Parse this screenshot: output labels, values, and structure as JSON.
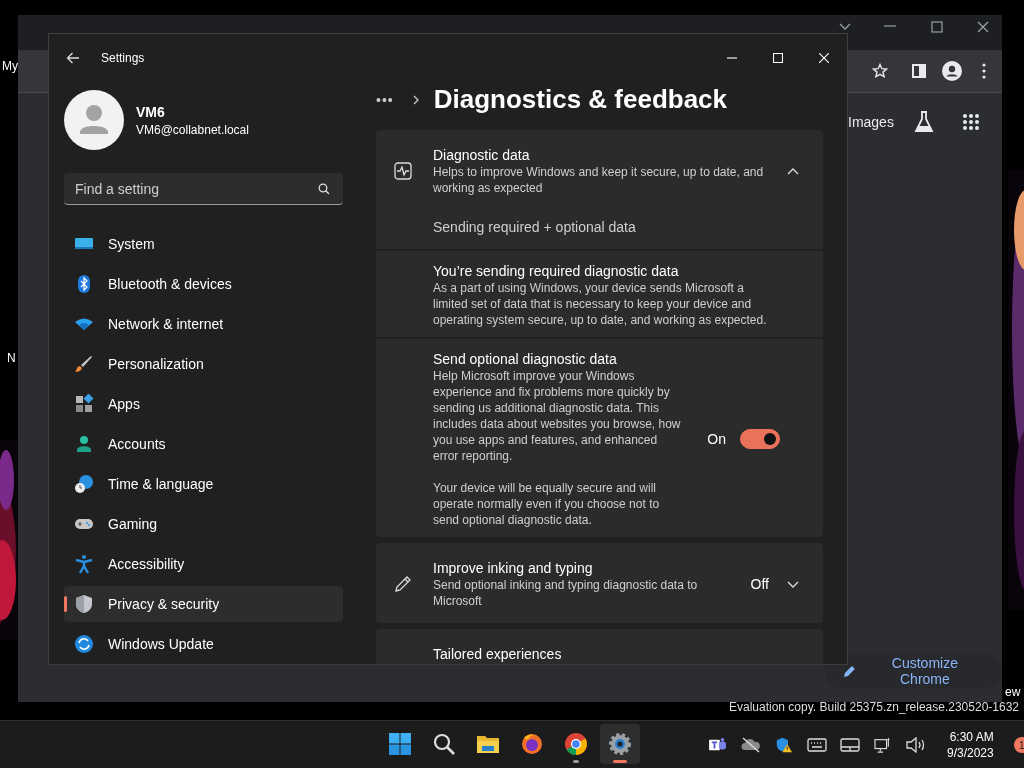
{
  "desktop": {
    "icon_labels": [
      {
        "text": "My",
        "kind": "top"
      },
      {
        "text": "N",
        "kind": "middle"
      },
      {
        "text": "ew",
        "kind": "right"
      }
    ],
    "build_info": "Evaluation copy. Build 25375.zn_release.230520-1632"
  },
  "browser": {
    "link": "Images",
    "customize_button": "Customize Chrome"
  },
  "settings": {
    "title": "Settings",
    "user": {
      "name": "VM6",
      "email": "VM6@collabnet.local"
    },
    "search": {
      "placeholder": "Find a setting"
    },
    "nav": [
      {
        "label": "System",
        "selected": false
      },
      {
        "label": "Bluetooth & devices",
        "selected": false
      },
      {
        "label": "Network & internet",
        "selected": false
      },
      {
        "label": "Personalization",
        "selected": false
      },
      {
        "label": "Apps",
        "selected": false
      },
      {
        "label": "Accounts",
        "selected": false
      },
      {
        "label": "Time & language",
        "selected": false
      },
      {
        "label": "Gaming",
        "selected": false
      },
      {
        "label": "Accessibility",
        "selected": false
      },
      {
        "label": "Privacy & security",
        "selected": true
      },
      {
        "label": "Windows Update",
        "selected": false
      }
    ],
    "breadcrumb": {
      "more": "•••",
      "title": "Diagnostics & feedback"
    },
    "cards": [
      {
        "kind": "expander",
        "title": "Diagnostic data",
        "description": "Helps to improve Windows and keep it secure, up to date, and working as expected",
        "expanded": true,
        "value": "Sending required + optional data",
        "children": [
          {
            "kind": "info",
            "title": "You’re sending required diagnostic data",
            "description": "As a part of using Windows, your device sends Microsoft a limited set of data that is necessary to keep your device and operating system secure, up to date, and working as expected."
          },
          {
            "kind": "toggle",
            "title": "Send optional diagnostic data",
            "description": "Help Microsoft improve your Windows experience and fix problems more quickly by sending us additional diagnostic data. This includes data about websites you browse, how you use apps and features, and enhanced error reporting.",
            "note": "Your device will be equally secure and will operate normally even if you choose not to send optional diagnostic data.",
            "state_label": "On",
            "on": true
          }
        ]
      },
      {
        "kind": "expander",
        "title": "Improve inking and typing",
        "description": "Send optional inking and typing diagnostic data to Microsoft",
        "expanded": false,
        "state_label": "Off"
      },
      {
        "kind": "partial",
        "title": "Tailored experiences"
      }
    ]
  },
  "taskbar": {
    "apps": [
      {
        "kind": "start",
        "running": false,
        "selected": false
      },
      {
        "kind": "search",
        "running": false,
        "selected": false
      },
      {
        "kind": "files",
        "running": false,
        "selected": false
      },
      {
        "kind": "firefox",
        "running": false,
        "selected": false
      },
      {
        "kind": "chrome",
        "running": true,
        "selected": false
      },
      {
        "kind": "settings",
        "running": true,
        "selected": true
      }
    ],
    "time": "6:30 AM",
    "date": "9/3/2023",
    "notifications": "1"
  }
}
